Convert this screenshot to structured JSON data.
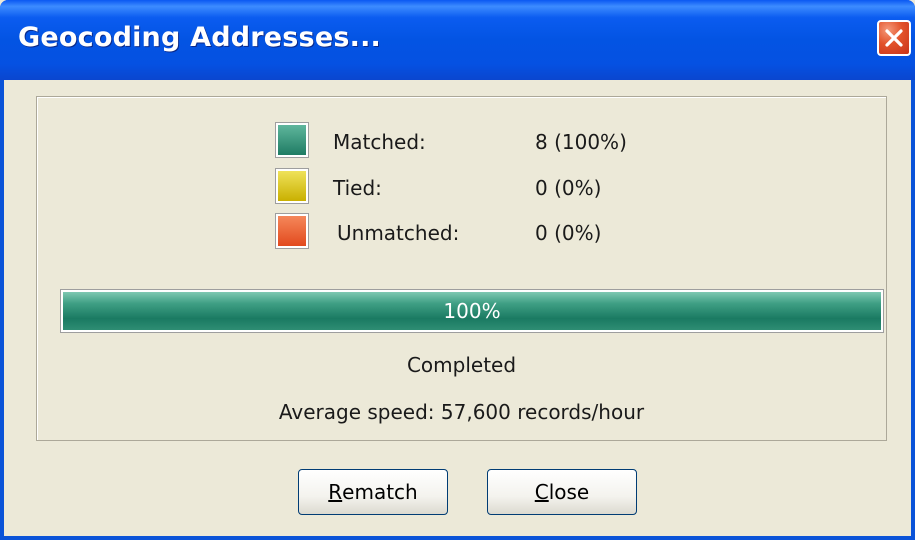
{
  "window": {
    "title": "Geocoding Addresses...",
    "close_icon": "close-icon",
    "close_color": "#e2522a"
  },
  "legend": [
    {
      "label": "Matched:",
      "value": "8 (100%)",
      "color": "#2f8c73"
    },
    {
      "label": "Tied:",
      "value": "0 (0%)",
      "color": "#d9c400"
    },
    {
      "label": "Unmatched:",
      "value": "0 (0%)",
      "color": "#ec5f2e"
    }
  ],
  "progress": {
    "label": "100%",
    "fraction": 1.0,
    "color": "#1a7a62"
  },
  "status": {
    "text": "Completed",
    "speed": "Average speed: 57,600 records/hour"
  },
  "buttons": {
    "rematch": {
      "accel": "R",
      "rest": "ematch"
    },
    "close": {
      "accel": "C",
      "rest": "lose"
    }
  }
}
